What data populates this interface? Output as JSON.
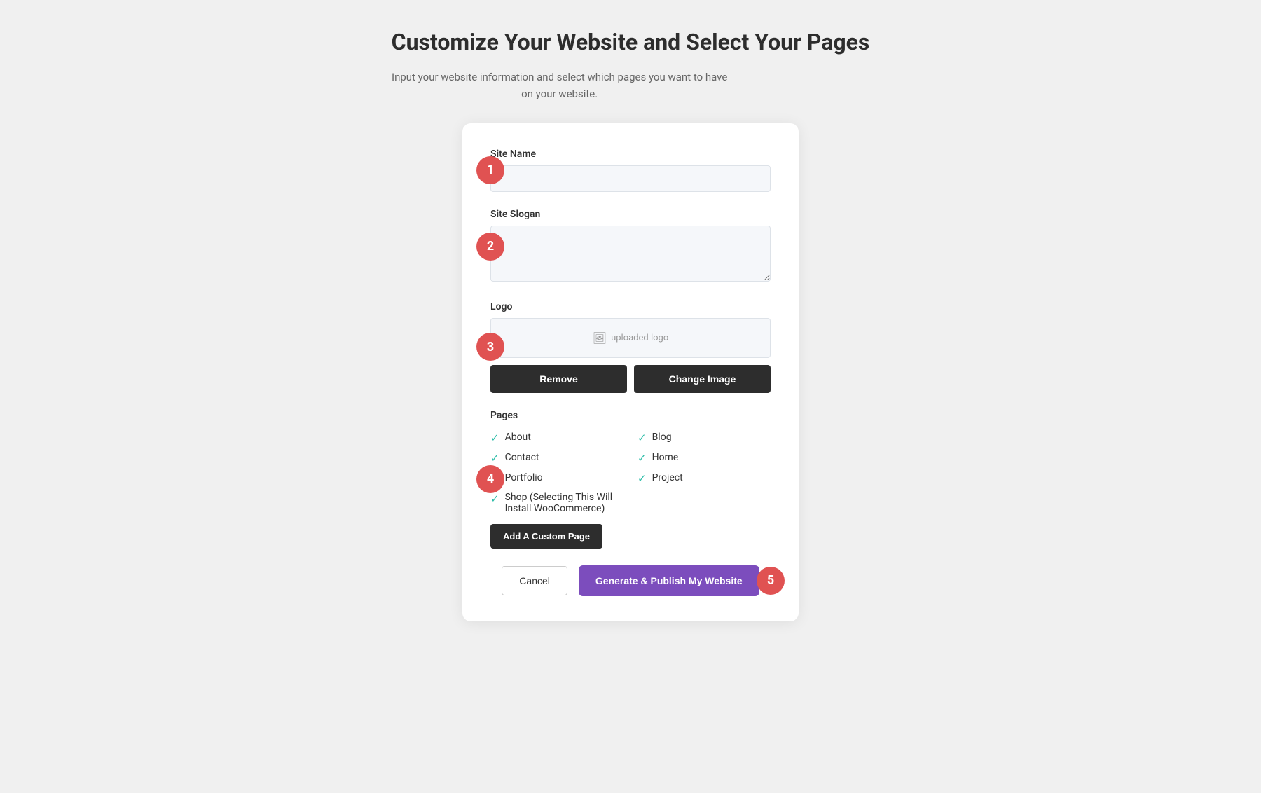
{
  "header": {
    "title": "Customize Your Website and Select Your Pages",
    "subtitle": "Input your website information and select which pages you want to have on your website."
  },
  "form": {
    "site_name_label": "Site Name",
    "site_name_placeholder": "",
    "site_slogan_label": "Site Slogan",
    "site_slogan_placeholder": "",
    "logo_label": "Logo",
    "logo_preview_text": "uploaded logo",
    "remove_button": "Remove",
    "change_image_button": "Change Image",
    "pages_label": "Pages",
    "pages": [
      {
        "label": "About",
        "checked": true,
        "col": 1
      },
      {
        "label": "Blog",
        "checked": true,
        "col": 2
      },
      {
        "label": "Contact",
        "checked": true,
        "col": 1
      },
      {
        "label": "Home",
        "checked": true,
        "col": 2
      },
      {
        "label": "Portfolio",
        "checked": true,
        "col": 1
      },
      {
        "label": "Project",
        "checked": true,
        "col": 2
      },
      {
        "label": "Shop (Selecting This Will Install WooCommerce)",
        "checked": true,
        "col": "full"
      }
    ],
    "add_custom_page_button": "Add A Custom Page",
    "cancel_button": "Cancel",
    "generate_button": "Generate & Publish My Website"
  },
  "steps": {
    "step1": "1",
    "step2": "2",
    "step3": "3",
    "step4": "4",
    "step5": "5"
  },
  "icons": {
    "check": "✓"
  }
}
